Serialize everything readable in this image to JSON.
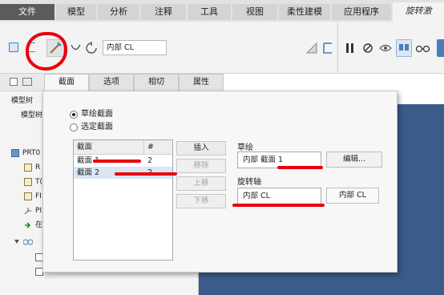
{
  "ribbon": {
    "tabs": [
      {
        "label": "文件"
      },
      {
        "label": "模型"
      },
      {
        "label": "分析"
      },
      {
        "label": "注释"
      },
      {
        "label": "工具"
      },
      {
        "label": "视图"
      },
      {
        "label": "柔性建模"
      },
      {
        "label": "应用程序"
      },
      {
        "label": "旋转激"
      }
    ]
  },
  "toolbar": {
    "axis_field_value": "内部 CL",
    "icons": [
      "solid-icon",
      "surface-icon",
      "sketch-section-icon",
      "flip-icon",
      "angle-icon",
      "remove-material-icon",
      "thicken-icon",
      "pause-icon",
      "no-preview-icon",
      "geometry-preview-icon",
      "verify-icon",
      "glasses-icon"
    ]
  },
  "tree": {
    "header_label": "模型树",
    "sub_label": "模型树",
    "rows": [
      {
        "label": "PRT0"
      },
      {
        "label": "R"
      },
      {
        "label": "T("
      },
      {
        "label": "FI"
      },
      {
        "label": "PI"
      },
      {
        "label": "在"
      }
    ]
  },
  "dashboard_tabs": [
    {
      "label": "截面"
    },
    {
      "label": "选项"
    },
    {
      "label": "相切"
    },
    {
      "label": "属性"
    }
  ],
  "sections_panel": {
    "radio_options": [
      {
        "label": "草绘截面",
        "selected": true
      },
      {
        "label": "选定截面",
        "selected": false
      }
    ],
    "table": {
      "headers": [
        "截面",
        "#"
      ],
      "rows": [
        {
          "section": "截面 1",
          "num": "2"
        },
        {
          "section": "截面 2",
          "num": "2"
        }
      ]
    },
    "buttons": {
      "insert": "插入",
      "remove": "移除",
      "move_up": "上移",
      "move_down": "下移"
    },
    "sketch": {
      "label": "草绘",
      "value": "内部 截面 1",
      "edit_button": "编辑..."
    },
    "axis": {
      "label": "旋转轴",
      "value": "内部 CL",
      "button": "内部 CL"
    }
  },
  "colors": {
    "annotation_red": "#e8000d",
    "graphics_blue": "#3b5b8a",
    "icon_blue": "#4a7fb5"
  }
}
